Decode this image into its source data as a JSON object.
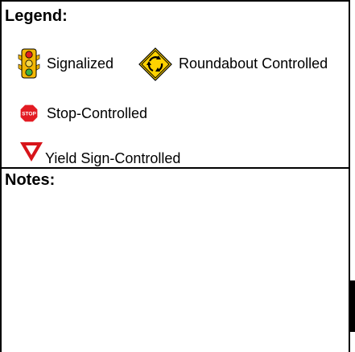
{
  "legend": {
    "heading": "Legend:",
    "items": [
      {
        "label": "Signalized",
        "icon": "traffic-light-icon"
      },
      {
        "label": "Roundabout Controlled",
        "icon": "roundabout-sign-icon"
      },
      {
        "label": "Stop-Controlled",
        "icon": "stop-sign-icon",
        "icon_text": "STOP"
      },
      {
        "label": "Yield Sign-Controlled",
        "icon": "yield-sign-icon"
      }
    ]
  },
  "notes": {
    "heading": "Notes:"
  },
  "colors": {
    "traffic_light_housing": "#F2B705",
    "signal_red": "#E02020",
    "signal_green": "#3CB043",
    "roundabout_sign": "#FFD200",
    "stop_sign": "#E31B23",
    "yield_sign": "#D7141A"
  }
}
